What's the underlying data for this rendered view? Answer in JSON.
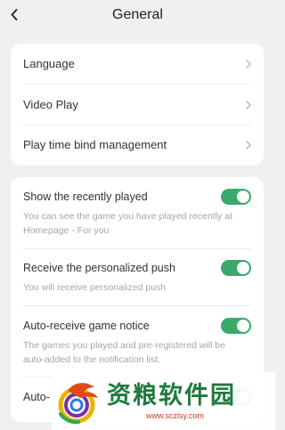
{
  "header": {
    "title": "General",
    "back_icon": "chevron-left-icon"
  },
  "nav_items": [
    {
      "label": "Language",
      "icon": "chevron-right-icon"
    },
    {
      "label": "Video Play",
      "icon": "chevron-right-icon"
    },
    {
      "label": "Play time bind management",
      "icon": "chevron-right-icon"
    }
  ],
  "toggles": [
    {
      "label": "Show the recently played",
      "description": "You can see the game you have played recently at Homepage - For you",
      "enabled": true
    },
    {
      "label": "Receive the personalized push",
      "description": "You will receive personalized push",
      "enabled": true
    },
    {
      "label": "Auto-receive game notice",
      "description": "The games you played and pre-registered will be auto-added to the notification list.",
      "enabled": true
    },
    {
      "label": "Auto-",
      "description": "",
      "enabled": true
    }
  ],
  "watermark": {
    "text": "资粮软件园",
    "url": "www.sczlsy.com"
  },
  "colors": {
    "background": "#eff0f2",
    "card": "#ffffff",
    "toggle_on": "#3aaa6b",
    "text_primary": "#333333",
    "text_secondary": "#a6a6a6"
  }
}
